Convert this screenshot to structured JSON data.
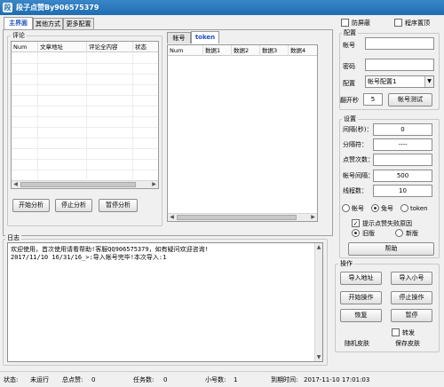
{
  "window": {
    "title": "段子点赞By906575379",
    "icon": "app-icon"
  },
  "top_checks": {
    "anti_block": "防屏蔽",
    "pin_top": "程序置顶"
  },
  "main_tabs": [
    "主界面",
    "其他方式",
    "更多配置"
  ],
  "comment_group": {
    "label": "评论",
    "columns": [
      "Num",
      "文章地址",
      "评论全内容",
      "状态"
    ],
    "buttons": {
      "start": "开始分析",
      "stop": "停止分析",
      "pause": "暂停分析"
    }
  },
  "account_tabs": [
    "帐号",
    "token"
  ],
  "account_grid": {
    "columns": [
      "Num",
      "数据1",
      "数据2",
      "数据3",
      "数据4"
    ]
  },
  "account_config": {
    "label": "配置",
    "account_label": "帐号",
    "password_label": "密码",
    "config_label": "配置",
    "config_select": "帐号配置1",
    "seconds_label": "翻开秒",
    "seconds_value": "5",
    "test_button": "帐号测试"
  },
  "settings": {
    "label": "设置",
    "interval_label": "间隔(秒)：",
    "interval_value": "0",
    "separator_label": "分隔符：",
    "separator_value": "----",
    "likes_label": "点赞次数：",
    "likes_value": "",
    "acct_interval_label": "帐号间隔：",
    "acct_interval_value": "500",
    "threads_label": "线程数：",
    "threads_value": "10",
    "mode_options": [
      "帐号",
      "免号",
      "token"
    ],
    "show_fail": "提示点赞失败原因",
    "order_options": [
      "旧版",
      "新版"
    ],
    "help_button": "帮助"
  },
  "log": {
    "label": "日志",
    "lines": [
      "欢迎使用，首次使用请看帮助!客服QQ906575379，如有疑问欢迎咨询!",
      "2017/11/10 16/31/16_>:导入帐号完毕!本次导入:1"
    ]
  },
  "operations": {
    "label": "操作",
    "import_url": "导入地址",
    "import_account": "导入小号",
    "start": "开始操作",
    "stop": "停止操作",
    "resume": "恢复",
    "pause": "暂停",
    "forward": "转发",
    "random_skin": "随机皮肤",
    "save_skin": "保存皮肤"
  },
  "status": {
    "state_label": "状态:",
    "state_value": "未运行",
    "total_likes_label": "总点赞:",
    "total_likes_value": "0",
    "tasks_label": "任务数:",
    "tasks_value": "0",
    "accounts_label": "小号数:",
    "accounts_value": "1",
    "expiry_label": "到期时间:",
    "expiry_value": "2017-11-10 17:01:03"
  }
}
